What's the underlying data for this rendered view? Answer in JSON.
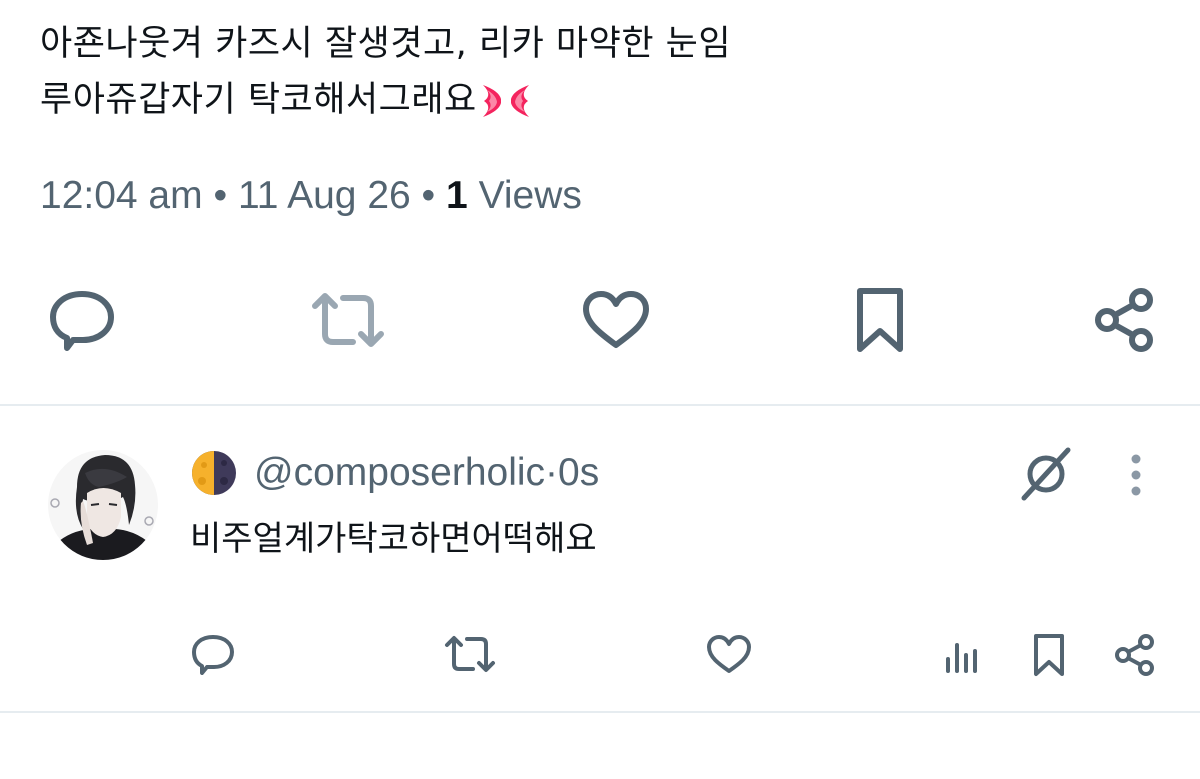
{
  "tweet": {
    "line1": "아죤나웃겨 카즈시 잘생겻고, 리카 마약한 눈임",
    "line2": "루아쥬갑자기 탁코해서그래요",
    "emoji": "anger-symbol-icon"
  },
  "meta": {
    "time": "12:04 am",
    "sep1": " • ",
    "date": "11 Aug 26",
    "sep2": " • ",
    "views_count": "1",
    "views_label": " Views"
  },
  "actions": [
    "reply-icon",
    "retweet-icon",
    "like-icon",
    "bookmark-icon",
    "share-icon"
  ],
  "reply": {
    "handle": "@composerholic",
    "dot": " · ",
    "time": "0s",
    "text": "비주얼계가탁코하면어떡해요"
  },
  "colors": {
    "icon_dark": "#536471",
    "icon_light": "#8b98a5",
    "text": "#0f1419",
    "divider": "#e6ecf0",
    "anger": "#f4245e"
  }
}
